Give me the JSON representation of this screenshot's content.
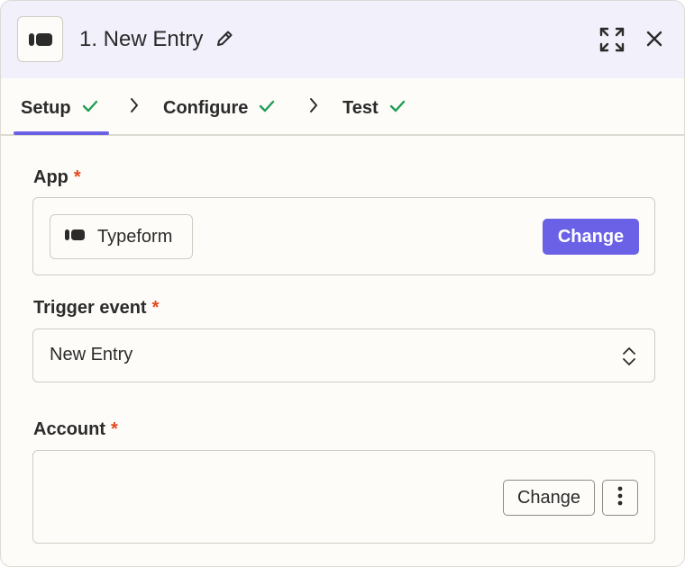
{
  "header": {
    "app_icon": "typeform-logo-icon",
    "title": "1. New Entry",
    "edit_icon": "pencil-icon",
    "expand_icon": "expand-icon",
    "close_icon": "close-icon"
  },
  "tabs": [
    {
      "label": "Setup",
      "complete": true,
      "active": true
    },
    {
      "label": "Configure",
      "complete": true,
      "active": false
    },
    {
      "label": "Test",
      "complete": true,
      "active": false
    }
  ],
  "fields": {
    "app": {
      "label": "App",
      "required_mark": "*",
      "value": "Typeform",
      "change_label": "Change"
    },
    "trigger_event": {
      "label": "Trigger event",
      "required_mark": "*",
      "value": "New Entry"
    },
    "account": {
      "label": "Account",
      "required_mark": "*",
      "value": "",
      "change_label": "Change"
    }
  },
  "colors": {
    "accent": "#6b61e6",
    "check": "#1f9d55",
    "required": "#e1491d",
    "header_bg": "#f1f0fb",
    "panel_bg": "#fdfcf8"
  }
}
